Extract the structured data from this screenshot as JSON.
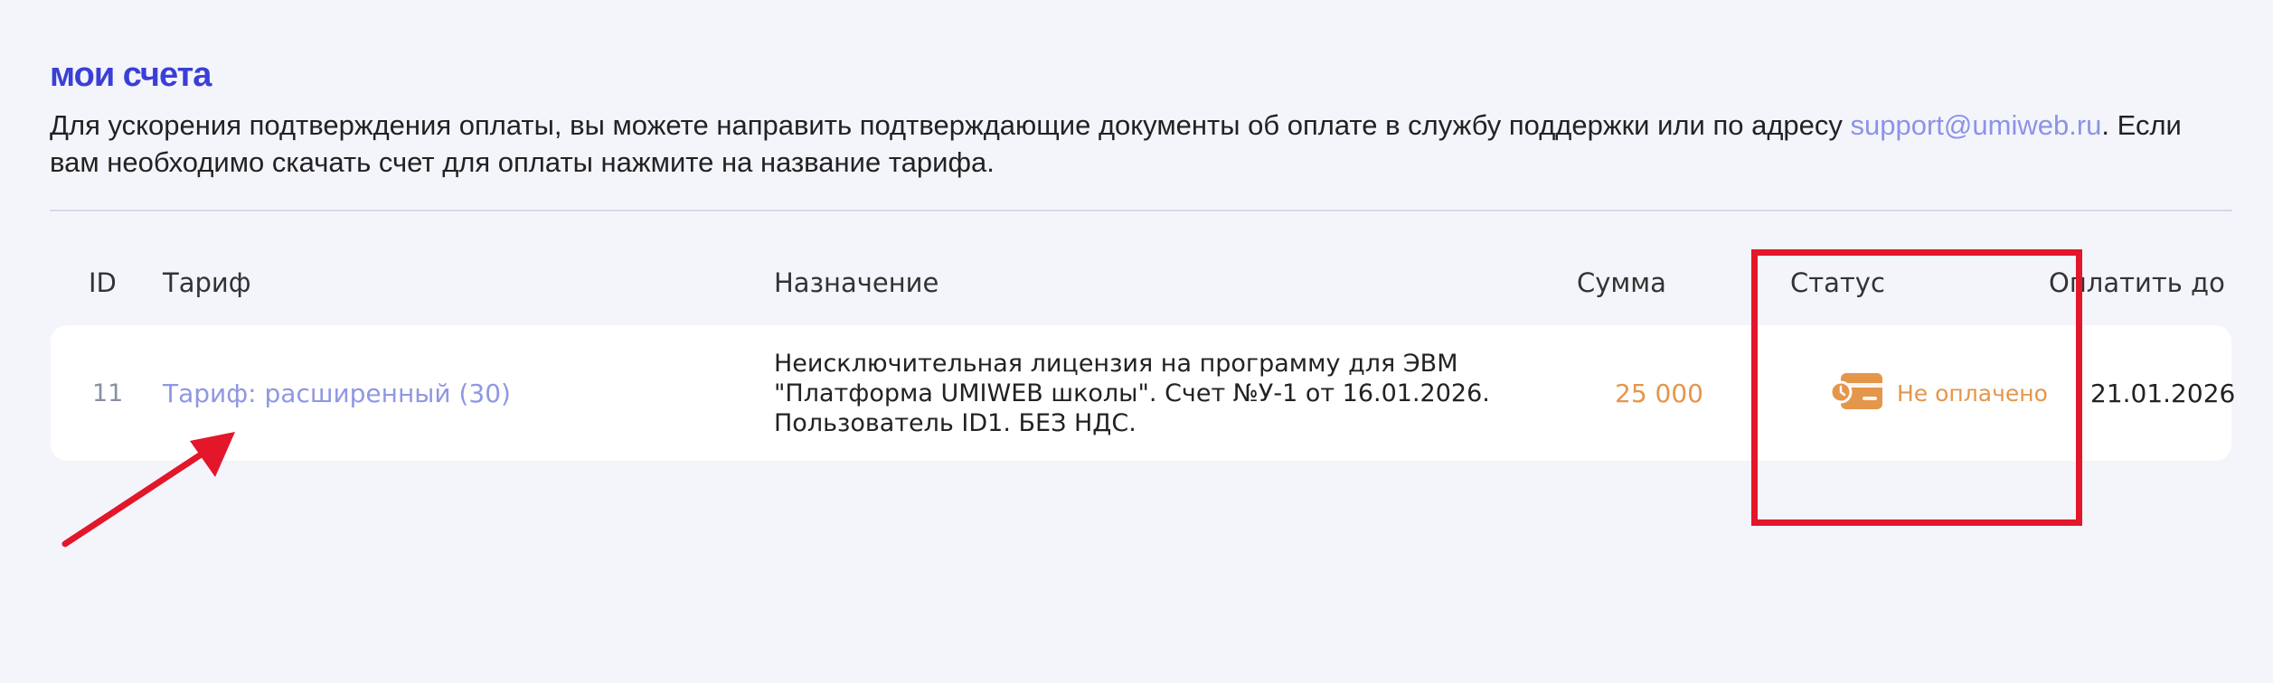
{
  "page": {
    "title": "мои счета",
    "description_before": "Для ускорения подтверждения оплаты, вы можете направить подтверждающие документы об оплате в службу поддержки или по адресу ",
    "support_email": "support@umiweb.ru",
    "description_after": ". Если вам необходимо скачать счет для оплаты нажмите на название тарифа."
  },
  "table": {
    "headers": {
      "id": "ID",
      "tariff": "Тариф",
      "purpose": "Назначение",
      "sum": "Сумма",
      "status": "Статус",
      "pay_by": "Оплатить до"
    },
    "rows": [
      {
        "id": "11",
        "tariff": "Тариф: расширенный (30)",
        "purpose": "Неисключительная лицензия на программу для ЭВМ \"Платформа UMIWEB школы\". Счет №У-1 от 16.01.2026. Пользователь ID1. БЕЗ НДС.",
        "sum": "25 000",
        "status": "Не оплачено",
        "status_icon": "unpaid-card-clock-icon",
        "pay_by": "21.01.2026"
      }
    ]
  },
  "colors": {
    "accent": "#3a3fd6",
    "link": "#8f97e3",
    "amount": "#e4964b",
    "annotation": "#e3162a"
  }
}
